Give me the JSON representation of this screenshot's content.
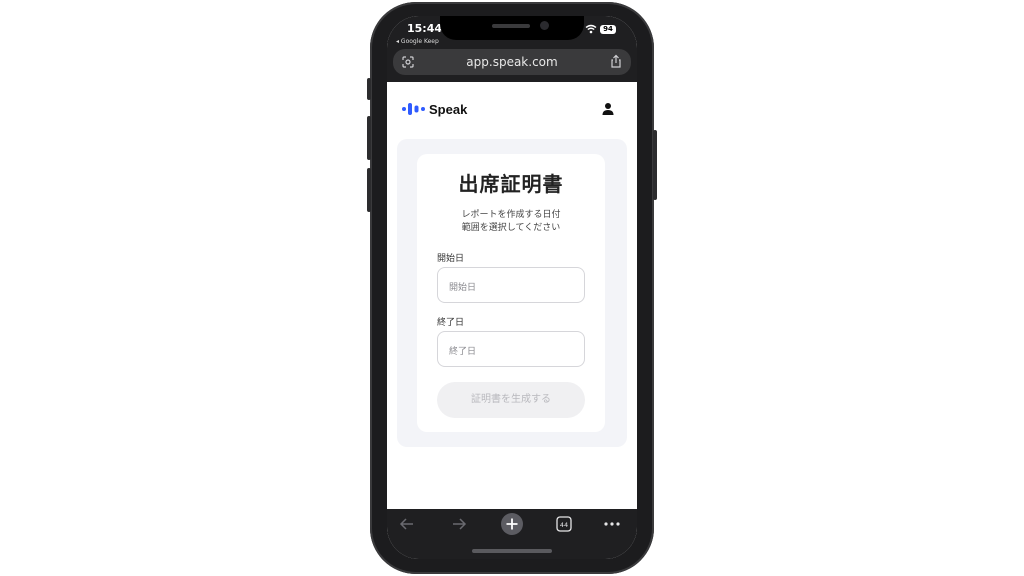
{
  "status_bar": {
    "time": "15:44",
    "back_app": "◂ Google Keep",
    "battery": "94"
  },
  "browser": {
    "url": "app.speak.com",
    "tab_count": "44"
  },
  "site": {
    "brand": "Speak"
  },
  "form": {
    "title": "出席証明書",
    "subtitle_line1": "レポートを作成する日付",
    "subtitle_line2": "範囲を選択してください",
    "start_label": "開始日",
    "start_placeholder": "開始日",
    "end_label": "終了日",
    "end_placeholder": "終了日",
    "submit_label": "証明書を生成する"
  },
  "icons": [
    "scan-icon",
    "share-icon",
    "user-icon",
    "back-arrow-icon",
    "forward-arrow-icon",
    "new-tab-icon",
    "tabs-icon",
    "more-icon",
    "wifi-icon",
    "signal-icon"
  ],
  "colors": {
    "brand_blue": "#2f5bff",
    "panel_bg": "#f3f4f8",
    "button_disabled_bg": "#f0f0f2",
    "button_disabled_text": "#b9b9be",
    "browser_chrome": "#1f1f21"
  }
}
